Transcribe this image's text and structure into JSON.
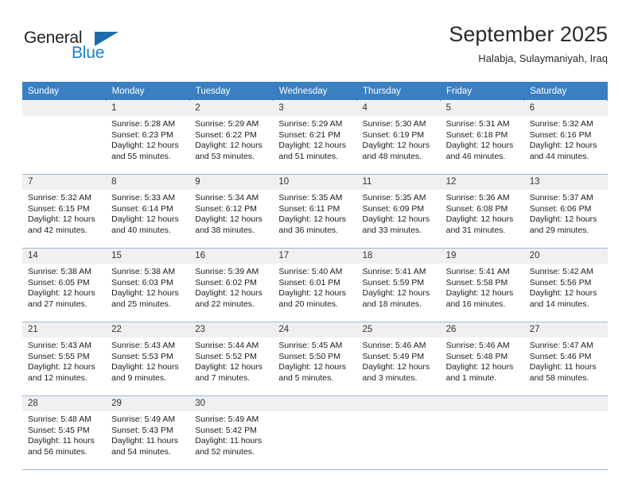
{
  "brand": {
    "word_one": "General",
    "word_two": "Blue",
    "logo_icon": "triangle-flag-icon",
    "accent_color": "#1b6ca8",
    "blue_text_color": "#1f7fc4"
  },
  "header": {
    "title": "September 2025",
    "subtitle": "Halabja, Sulaymaniyah, Iraq"
  },
  "calendar": {
    "header_bg": "#3a7fc1",
    "daynum_bg": "#f0f0f0",
    "weekdays": [
      "Sunday",
      "Monday",
      "Tuesday",
      "Wednesday",
      "Thursday",
      "Friday",
      "Saturday"
    ],
    "weeks": [
      [
        {
          "day": "",
          "sunrise": "",
          "sunset": "",
          "daylight_1": "",
          "daylight_2": ""
        },
        {
          "day": "1",
          "sunrise": "Sunrise: 5:28 AM",
          "sunset": "Sunset: 6:23 PM",
          "daylight_1": "Daylight: 12 hours",
          "daylight_2": "and 55 minutes."
        },
        {
          "day": "2",
          "sunrise": "Sunrise: 5:29 AM",
          "sunset": "Sunset: 6:22 PM",
          "daylight_1": "Daylight: 12 hours",
          "daylight_2": "and 53 minutes."
        },
        {
          "day": "3",
          "sunrise": "Sunrise: 5:29 AM",
          "sunset": "Sunset: 6:21 PM",
          "daylight_1": "Daylight: 12 hours",
          "daylight_2": "and 51 minutes."
        },
        {
          "day": "4",
          "sunrise": "Sunrise: 5:30 AM",
          "sunset": "Sunset: 6:19 PM",
          "daylight_1": "Daylight: 12 hours",
          "daylight_2": "and 48 minutes."
        },
        {
          "day": "5",
          "sunrise": "Sunrise: 5:31 AM",
          "sunset": "Sunset: 6:18 PM",
          "daylight_1": "Daylight: 12 hours",
          "daylight_2": "and 46 minutes."
        },
        {
          "day": "6",
          "sunrise": "Sunrise: 5:32 AM",
          "sunset": "Sunset: 6:16 PM",
          "daylight_1": "Daylight: 12 hours",
          "daylight_2": "and 44 minutes."
        }
      ],
      [
        {
          "day": "7",
          "sunrise": "Sunrise: 5:32 AM",
          "sunset": "Sunset: 6:15 PM",
          "daylight_1": "Daylight: 12 hours",
          "daylight_2": "and 42 minutes."
        },
        {
          "day": "8",
          "sunrise": "Sunrise: 5:33 AM",
          "sunset": "Sunset: 6:14 PM",
          "daylight_1": "Daylight: 12 hours",
          "daylight_2": "and 40 minutes."
        },
        {
          "day": "9",
          "sunrise": "Sunrise: 5:34 AM",
          "sunset": "Sunset: 6:12 PM",
          "daylight_1": "Daylight: 12 hours",
          "daylight_2": "and 38 minutes."
        },
        {
          "day": "10",
          "sunrise": "Sunrise: 5:35 AM",
          "sunset": "Sunset: 6:11 PM",
          "daylight_1": "Daylight: 12 hours",
          "daylight_2": "and 36 minutes."
        },
        {
          "day": "11",
          "sunrise": "Sunrise: 5:35 AM",
          "sunset": "Sunset: 6:09 PM",
          "daylight_1": "Daylight: 12 hours",
          "daylight_2": "and 33 minutes."
        },
        {
          "day": "12",
          "sunrise": "Sunrise: 5:36 AM",
          "sunset": "Sunset: 6:08 PM",
          "daylight_1": "Daylight: 12 hours",
          "daylight_2": "and 31 minutes."
        },
        {
          "day": "13",
          "sunrise": "Sunrise: 5:37 AM",
          "sunset": "Sunset: 6:06 PM",
          "daylight_1": "Daylight: 12 hours",
          "daylight_2": "and 29 minutes."
        }
      ],
      [
        {
          "day": "14",
          "sunrise": "Sunrise: 5:38 AM",
          "sunset": "Sunset: 6:05 PM",
          "daylight_1": "Daylight: 12 hours",
          "daylight_2": "and 27 minutes."
        },
        {
          "day": "15",
          "sunrise": "Sunrise: 5:38 AM",
          "sunset": "Sunset: 6:03 PM",
          "daylight_1": "Daylight: 12 hours",
          "daylight_2": "and 25 minutes."
        },
        {
          "day": "16",
          "sunrise": "Sunrise: 5:39 AM",
          "sunset": "Sunset: 6:02 PM",
          "daylight_1": "Daylight: 12 hours",
          "daylight_2": "and 22 minutes."
        },
        {
          "day": "17",
          "sunrise": "Sunrise: 5:40 AM",
          "sunset": "Sunset: 6:01 PM",
          "daylight_1": "Daylight: 12 hours",
          "daylight_2": "and 20 minutes."
        },
        {
          "day": "18",
          "sunrise": "Sunrise: 5:41 AM",
          "sunset": "Sunset: 5:59 PM",
          "daylight_1": "Daylight: 12 hours",
          "daylight_2": "and 18 minutes."
        },
        {
          "day": "19",
          "sunrise": "Sunrise: 5:41 AM",
          "sunset": "Sunset: 5:58 PM",
          "daylight_1": "Daylight: 12 hours",
          "daylight_2": "and 16 minutes."
        },
        {
          "day": "20",
          "sunrise": "Sunrise: 5:42 AM",
          "sunset": "Sunset: 5:56 PM",
          "daylight_1": "Daylight: 12 hours",
          "daylight_2": "and 14 minutes."
        }
      ],
      [
        {
          "day": "21",
          "sunrise": "Sunrise: 5:43 AM",
          "sunset": "Sunset: 5:55 PM",
          "daylight_1": "Daylight: 12 hours",
          "daylight_2": "and 12 minutes."
        },
        {
          "day": "22",
          "sunrise": "Sunrise: 5:43 AM",
          "sunset": "Sunset: 5:53 PM",
          "daylight_1": "Daylight: 12 hours",
          "daylight_2": "and 9 minutes."
        },
        {
          "day": "23",
          "sunrise": "Sunrise: 5:44 AM",
          "sunset": "Sunset: 5:52 PM",
          "daylight_1": "Daylight: 12 hours",
          "daylight_2": "and 7 minutes."
        },
        {
          "day": "24",
          "sunrise": "Sunrise: 5:45 AM",
          "sunset": "Sunset: 5:50 PM",
          "daylight_1": "Daylight: 12 hours",
          "daylight_2": "and 5 minutes."
        },
        {
          "day": "25",
          "sunrise": "Sunrise: 5:46 AM",
          "sunset": "Sunset: 5:49 PM",
          "daylight_1": "Daylight: 12 hours",
          "daylight_2": "and 3 minutes."
        },
        {
          "day": "26",
          "sunrise": "Sunrise: 5:46 AM",
          "sunset": "Sunset: 5:48 PM",
          "daylight_1": "Daylight: 12 hours",
          "daylight_2": "and 1 minute."
        },
        {
          "day": "27",
          "sunrise": "Sunrise: 5:47 AM",
          "sunset": "Sunset: 5:46 PM",
          "daylight_1": "Daylight: 11 hours",
          "daylight_2": "and 58 minutes."
        }
      ],
      [
        {
          "day": "28",
          "sunrise": "Sunrise: 5:48 AM",
          "sunset": "Sunset: 5:45 PM",
          "daylight_1": "Daylight: 11 hours",
          "daylight_2": "and 56 minutes."
        },
        {
          "day": "29",
          "sunrise": "Sunrise: 5:49 AM",
          "sunset": "Sunset: 5:43 PM",
          "daylight_1": "Daylight: 11 hours",
          "daylight_2": "and 54 minutes."
        },
        {
          "day": "30",
          "sunrise": "Sunrise: 5:49 AM",
          "sunset": "Sunset: 5:42 PM",
          "daylight_1": "Daylight: 11 hours",
          "daylight_2": "and 52 minutes."
        },
        {
          "day": "",
          "sunrise": "",
          "sunset": "",
          "daylight_1": "",
          "daylight_2": ""
        },
        {
          "day": "",
          "sunrise": "",
          "sunset": "",
          "daylight_1": "",
          "daylight_2": ""
        },
        {
          "day": "",
          "sunrise": "",
          "sunset": "",
          "daylight_1": "",
          "daylight_2": ""
        },
        {
          "day": "",
          "sunrise": "",
          "sunset": "",
          "daylight_1": "",
          "daylight_2": ""
        }
      ]
    ]
  }
}
